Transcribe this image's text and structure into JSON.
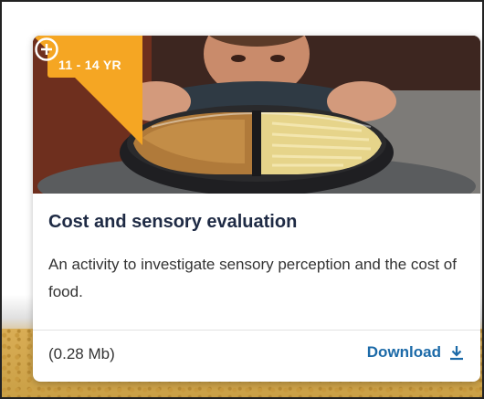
{
  "card": {
    "age_badge": "11 - 14 YR",
    "title": "Cost and sensory evaluation",
    "description": "An activity to investigate sensory perception and the cost of food.",
    "file_size": "(0.28 Mb)",
    "download_label": "Download",
    "add_icon": "plus-circle-icon",
    "download_icon": "download-icon",
    "image_subject": "hero-image",
    "colors": {
      "accent": "#f5a623",
      "link": "#1c6aa8",
      "title": "#1e2a44"
    }
  }
}
